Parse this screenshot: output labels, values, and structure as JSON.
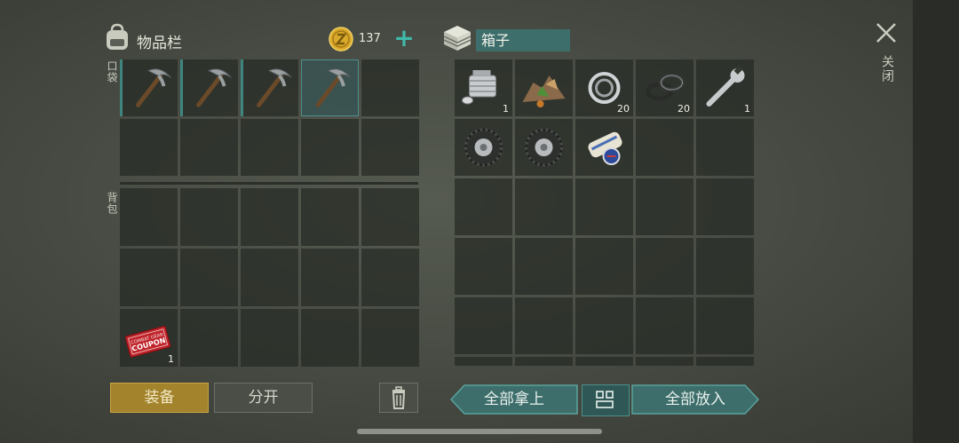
{
  "inventory": {
    "title": "物品栏",
    "coin_count": "137",
    "plus_label": "+",
    "pocket_label": "口袋",
    "backpack_label": "背包"
  },
  "pocket_slots": [
    {
      "item": "pickaxe-icon",
      "qty": "",
      "bar": true,
      "selected": false
    },
    {
      "item": "pickaxe-icon",
      "qty": "",
      "bar": true,
      "selected": false
    },
    {
      "item": "pickaxe-icon",
      "qty": "",
      "bar": true,
      "selected": false
    },
    {
      "item": "pickaxe-icon",
      "qty": "",
      "bar": false,
      "selected": true
    },
    {
      "item": "",
      "qty": ""
    },
    {
      "item": "",
      "qty": ""
    },
    {
      "item": "",
      "qty": ""
    },
    {
      "item": "",
      "qty": ""
    },
    {
      "item": "",
      "qty": ""
    },
    {
      "item": "",
      "qty": ""
    }
  ],
  "backpack_slots": [
    {
      "item": "",
      "qty": ""
    },
    {
      "item": "",
      "qty": ""
    },
    {
      "item": "",
      "qty": ""
    },
    {
      "item": "",
      "qty": ""
    },
    {
      "item": "",
      "qty": ""
    },
    {
      "item": "",
      "qty": ""
    },
    {
      "item": "",
      "qty": ""
    },
    {
      "item": "",
      "qty": ""
    },
    {
      "item": "",
      "qty": ""
    },
    {
      "item": "",
      "qty": ""
    },
    {
      "item": "coupon-icon",
      "qty": "1",
      "coupon_text_1": "COMBAT GEAR",
      "coupon_text_2": "COUPON"
    },
    {
      "item": "",
      "qty": ""
    },
    {
      "item": "",
      "qty": ""
    },
    {
      "item": "",
      "qty": ""
    },
    {
      "item": "",
      "qty": ""
    }
  ],
  "box": {
    "title": "箱子"
  },
  "box_slots": [
    {
      "item": "engine-block-icon",
      "qty": "1"
    },
    {
      "item": "ore-pile-icon",
      "qty": ""
    },
    {
      "item": "bearing-icon",
      "qty": "20"
    },
    {
      "item": "seal-ring-icon",
      "qty": "20"
    },
    {
      "item": "wrench-icon",
      "qty": "1"
    },
    {
      "item": "tire-icon",
      "qty": ""
    },
    {
      "item": "tire-icon",
      "qty": ""
    },
    {
      "item": "recipe-scroll-icon",
      "qty": ""
    },
    {
      "item": "",
      "qty": ""
    },
    {
      "item": "",
      "qty": ""
    },
    {
      "item": "",
      "qty": ""
    },
    {
      "item": "",
      "qty": ""
    },
    {
      "item": "",
      "qty": ""
    },
    {
      "item": "",
      "qty": ""
    },
    {
      "item": "",
      "qty": ""
    },
    {
      "item": "",
      "qty": ""
    },
    {
      "item": "",
      "qty": ""
    },
    {
      "item": "",
      "qty": ""
    },
    {
      "item": "",
      "qty": ""
    },
    {
      "item": "",
      "qty": ""
    },
    {
      "item": "",
      "qty": ""
    },
    {
      "item": "",
      "qty": ""
    },
    {
      "item": "",
      "qty": ""
    },
    {
      "item": "",
      "qty": ""
    },
    {
      "item": "",
      "qty": ""
    },
    {
      "item": "",
      "qty": ""
    },
    {
      "item": "",
      "qty": ""
    },
    {
      "item": "",
      "qty": ""
    },
    {
      "item": "",
      "qty": ""
    },
    {
      "item": "",
      "qty": ""
    }
  ],
  "buttons": {
    "equip": "装备",
    "split": "分开",
    "take_all": "全部拿上",
    "put_all": "全部放入",
    "close": "关闭"
  },
  "colors": {
    "accent_teal": "#3e8580",
    "equip_gold": "#a3842d",
    "coin_gold": "#d9a92c"
  }
}
